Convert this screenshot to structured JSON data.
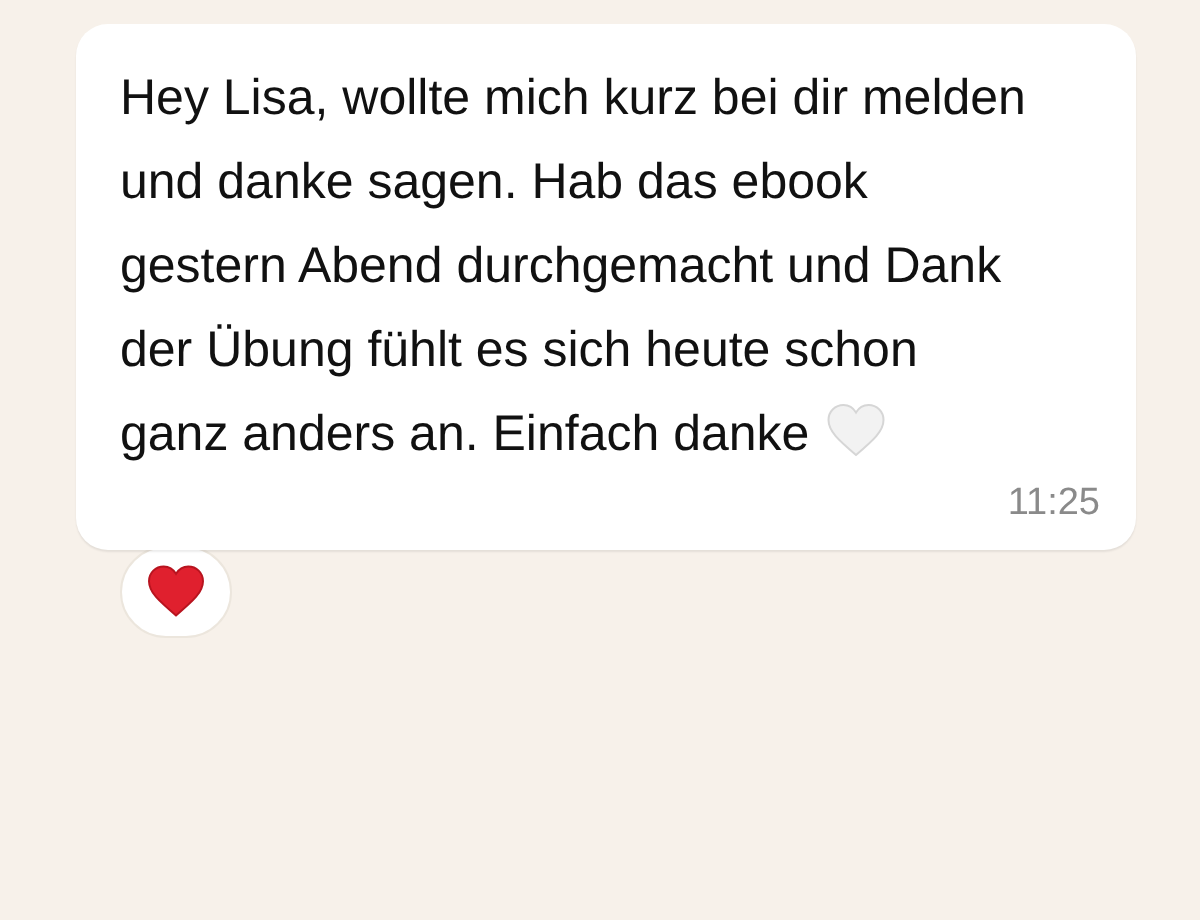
{
  "message": {
    "text": "Hey Lisa, wollte mich kurz bei dir melden und danke sagen. Hab das ebook gestern Abend durchgemacht und Dank der Übung fühlt es sich heute schon ganz anders an. Einfach danke",
    "time": "11:25"
  }
}
